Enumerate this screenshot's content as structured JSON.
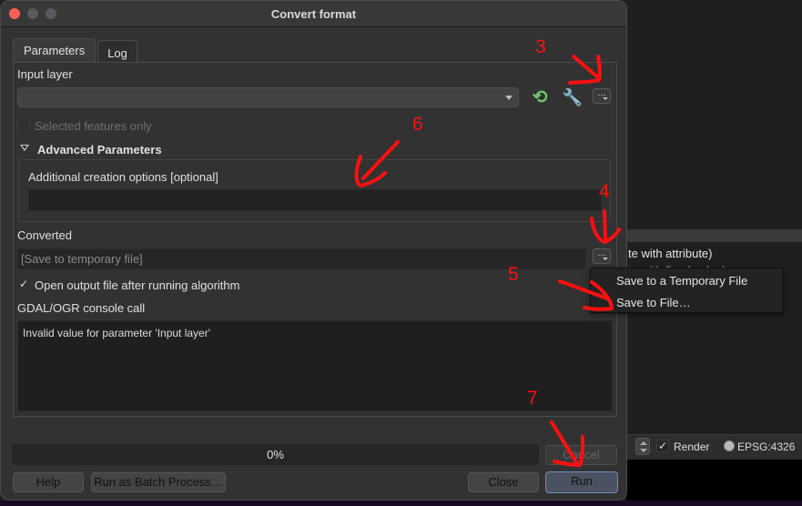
{
  "window": {
    "title": "Convert format",
    "traffic_lights": [
      "close",
      "minimize",
      "maximize"
    ]
  },
  "tabs": [
    {
      "label": "Parameters",
      "active": true
    },
    {
      "label": "Log",
      "active": false
    }
  ],
  "parameters": {
    "input_layer": {
      "label": "Input layer",
      "value": "",
      "icons": [
        "refresh-icon",
        "wrench-icon"
      ],
      "browse_label": "…"
    },
    "selected_features_only": {
      "label": "Selected features only",
      "checked": false,
      "enabled": false
    },
    "advanced": {
      "label": "Advanced Parameters",
      "expanded": true,
      "creation_options": {
        "label": "Additional creation options [optional]",
        "value": ""
      }
    },
    "converted": {
      "label": "Converted",
      "placeholder": "[Save to temporary file]",
      "browse_label": "…"
    },
    "open_output": {
      "label": "Open output file after running algorithm",
      "checked": true,
      "check_glyph": "✓"
    },
    "console": {
      "label": "GDAL/OGR console call",
      "text": "Invalid value for parameter 'Input layer'"
    }
  },
  "progress": {
    "value_percent": 0,
    "label": "0%"
  },
  "buttons": {
    "cancel": "Cancel",
    "help": "Help",
    "batch": "Run as Batch Process…",
    "close": "Close",
    "run": "Run"
  },
  "save_menu": {
    "items": [
      "Save to a Temporary File",
      "Save to File…"
    ]
  },
  "background_app": {
    "layer_line_1": "te with attribute)",
    "layer_line_2": "te with fixed value)",
    "render_label": "Render",
    "render_checked": true,
    "check_glyph": "✓",
    "crs": "EPSG:4326"
  },
  "annotations": {
    "color": "#ff0f0f",
    "steps": [
      "3",
      "4",
      "5",
      "6",
      "7"
    ]
  }
}
